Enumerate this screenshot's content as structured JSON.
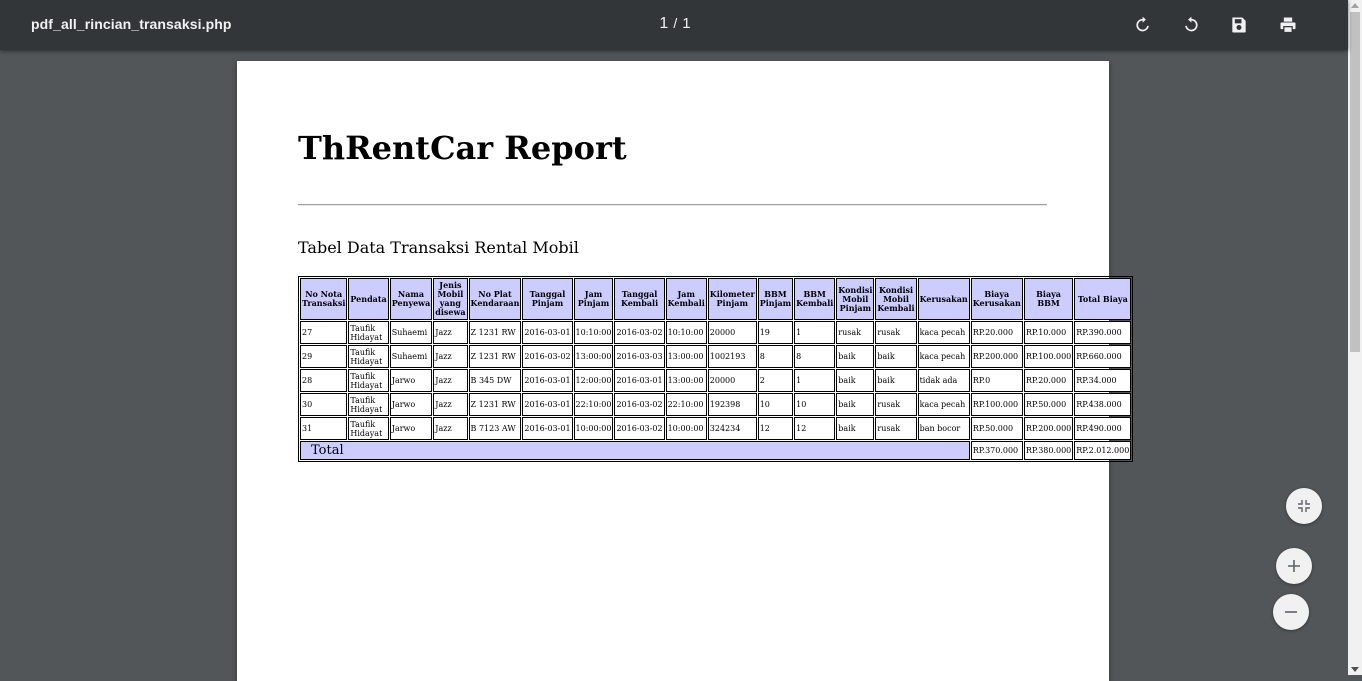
{
  "viewer": {
    "title": "pdf_all_rincian_transaksi.php",
    "page_current": "1",
    "page_sep": "/",
    "page_total": "1",
    "icons": [
      "rotate-clockwise-icon",
      "rotate-counterclockwise-icon",
      "save-icon",
      "print-icon"
    ],
    "zoom_controls": [
      "fit-to-page-icon",
      "zoom-in-icon",
      "zoom-out-icon"
    ]
  },
  "report": {
    "title": "ThRentCar Report",
    "subtitle": "Tabel Data Transaksi Rental Mobil",
    "headers": [
      "No Nota Transaksi",
      "Pendata",
      "Nama Penyewa",
      "Jenis Mobil yang disewa",
      "No Plat Kendaraan",
      "Tanggal Pinjam",
      "Jam Pinjam",
      "Tanggal Kembali",
      "Jam Kembali",
      "Kilometer Pinjam",
      "BBM Pinjam",
      "BBM Kembali",
      "Kondisi Mobil Pinjam",
      "Kondisi Mobil Kembali",
      "Kerusakan",
      "Biaya Kerusakan",
      "Biaya BBM",
      "Total Biaya"
    ],
    "rows": [
      [
        "27",
        "Taufik Hidayat",
        "Suhaemi",
        "Jazz",
        "Z 1231 RW",
        "2016-03-01",
        "10:10:00",
        "2016-03-02",
        "10:10:00",
        "20000",
        "19",
        "1",
        "rusak",
        "rusak",
        "kaca pecah",
        "RP.20.000",
        "RP.10.000",
        "RP.390.000"
      ],
      [
        "29",
        "Taufik Hidayat",
        "Suhaemi",
        "Jazz",
        "Z 1231 RW",
        "2016-03-02",
        "13:00:00",
        "2016-03-03",
        "13:00:00",
        "1002193",
        "8",
        "8",
        "baik",
        "baik",
        "kaca pecah",
        "RP.200.000",
        "RP.100.000",
        "RP.660.000"
      ],
      [
        "28",
        "Taufik Hidayat",
        "Jarwo",
        "Jazz",
        "B 345 DW",
        "2016-03-01",
        "12:00:00",
        "2016-03-01",
        "13:00:00",
        "20000",
        "2",
        "1",
        "baik",
        "baik",
        "tidak ada",
        "RP.0",
        "RP.20.000",
        "RP.34.000"
      ],
      [
        "30",
        "Taufik Hidayat",
        "Jarwo",
        "Jazz",
        "Z 1231 RW",
        "2016-03-01",
        "22:10:00",
        "2016-03-02",
        "22:10:00",
        "192398",
        "10",
        "10",
        "baik",
        "rusak",
        "kaca pecah",
        "RP.100.000",
        "RP.50.000",
        "RP.438.000"
      ],
      [
        "31",
        "Taufik Hidayat",
        "Jarwo",
        "Jazz",
        "B 7123 AW",
        "2016-03-01",
        "10:00:00",
        "2016-03-02",
        "10:00:00",
        "324234",
        "12",
        "12",
        "baik",
        "rusak",
        "ban bocor",
        "RP.50.000",
        "RP.200.000",
        "RP.490.000"
      ]
    ],
    "total": {
      "label": "Total",
      "biaya_kerusakan": "RP.370.000",
      "biaya_bbm": "RP.380.000",
      "total_biaya": "RP.2.012.000"
    }
  }
}
